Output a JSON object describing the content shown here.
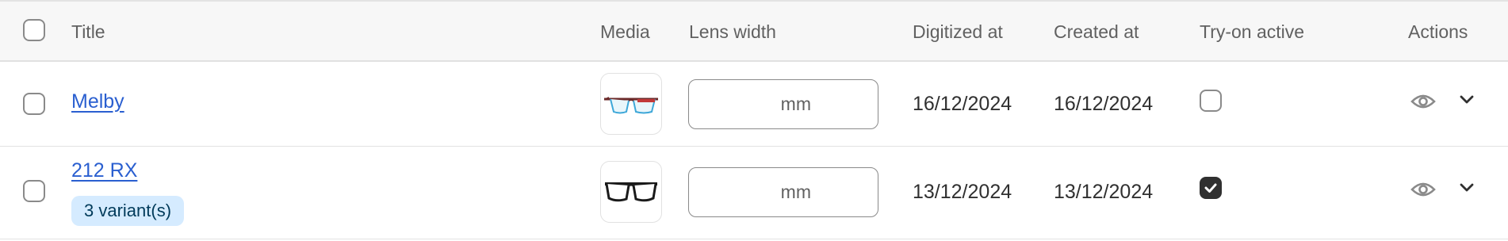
{
  "header": {
    "title": "Title",
    "media": "Media",
    "lens_width": "Lens width",
    "digitized_at": "Digitized at",
    "created_at": "Created at",
    "tryon_active": "Try-on active",
    "actions": "Actions"
  },
  "rows": [
    {
      "title": "Melby",
      "variants": "",
      "lens_width_value": "",
      "lens_width_unit": "mm",
      "digitized_at": "16/12/2024",
      "created_at": "16/12/2024",
      "tryon_active": false,
      "media_icon": "glasses-thin-icon"
    },
    {
      "title": "212 RX",
      "variants": "3 variant(s)",
      "lens_width_value": "",
      "lens_width_unit": "mm",
      "digitized_at": "13/12/2024",
      "created_at": "13/12/2024",
      "tryon_active": true,
      "media_icon": "glasses-bold-icon"
    }
  ],
  "colors": {
    "link": "#2a5fd0",
    "badge_bg": "#d5ebff",
    "header_bg": "#f7f7f7"
  }
}
